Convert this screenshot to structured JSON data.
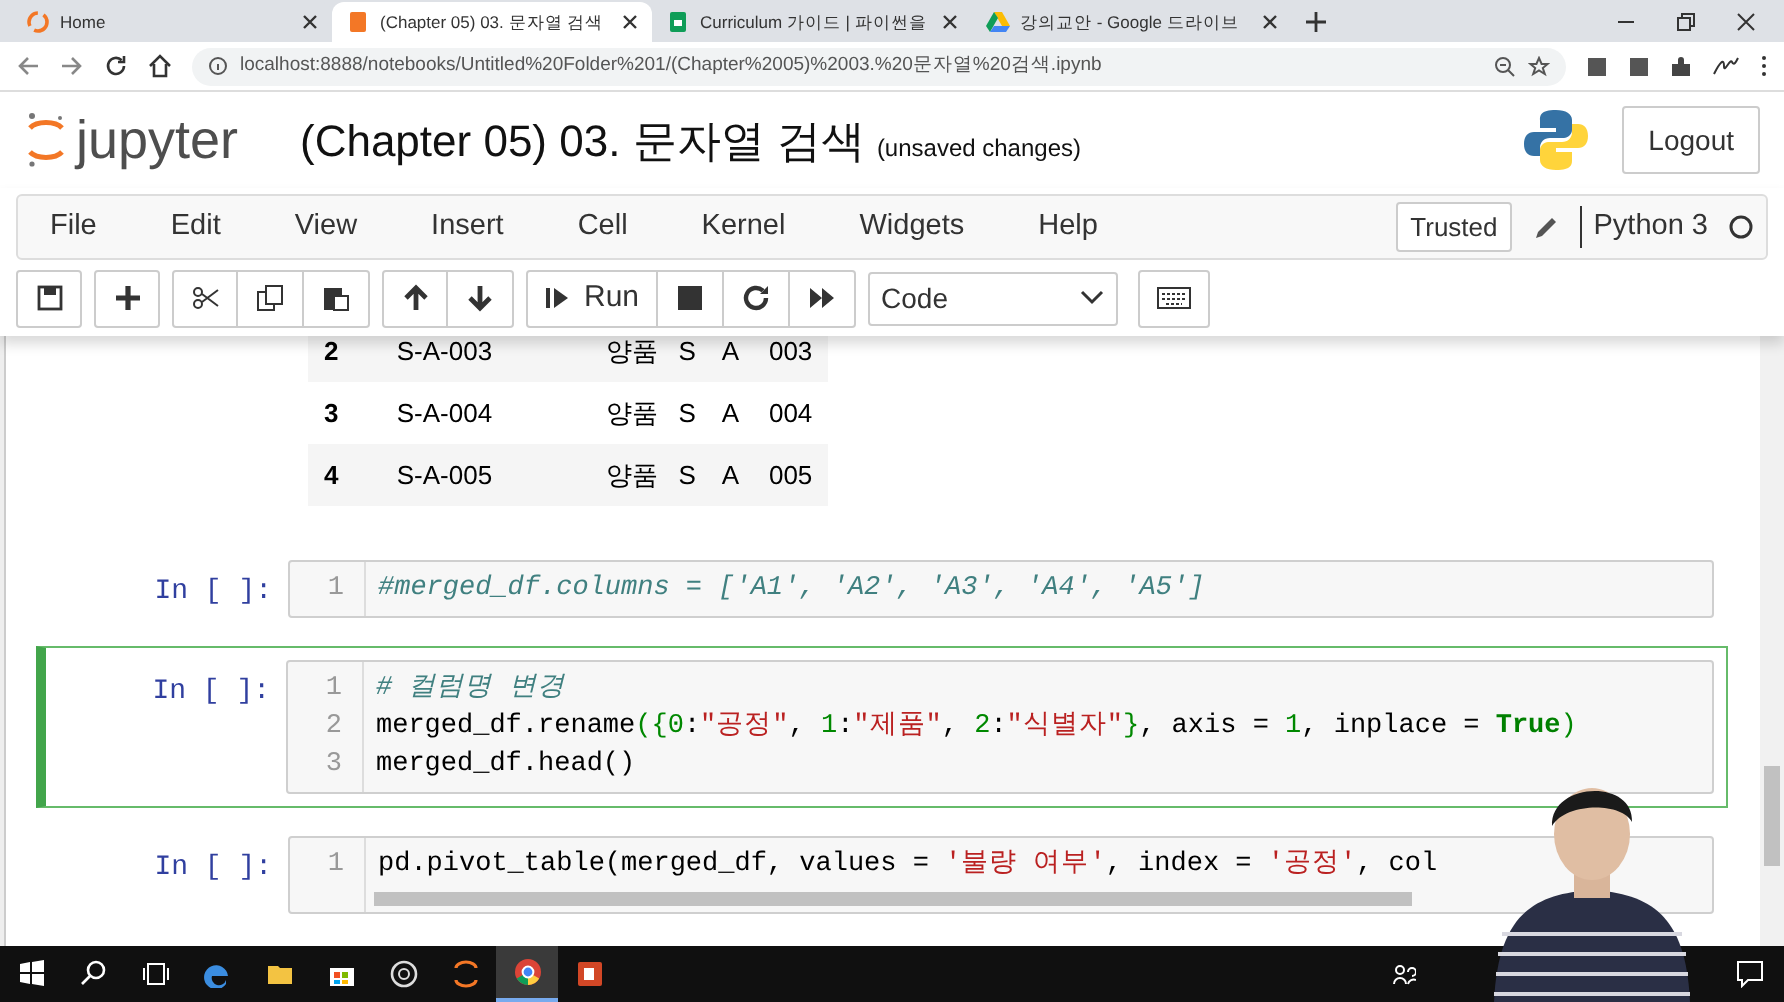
{
  "browser": {
    "tabs": [
      {
        "label": "Home",
        "selected": false,
        "kind": "jupyter"
      },
      {
        "label": "(Chapter 05) 03. 문자열 검색",
        "selected": true,
        "kind": "notebook"
      },
      {
        "label": "Curriculum 가이드 | 파이썬을",
        "selected": false,
        "kind": "sheets"
      },
      {
        "label": "강의교안 - Google 드라이브",
        "selected": false,
        "kind": "drive"
      }
    ],
    "address": "localhost:8888/notebooks/Untitled%20Folder%201/(Chapter%2005)%2003.%20문자열%20검색.ipynb"
  },
  "header": {
    "logo": "jupyter",
    "title": "(Chapter 05) 03. 문자열 검색",
    "status": "(unsaved changes)",
    "logout": "Logout"
  },
  "menu": {
    "items": [
      "File",
      "Edit",
      "View",
      "Insert",
      "Cell",
      "Kernel",
      "Widgets",
      "Help"
    ],
    "trusted": "Trusted",
    "kernel": "Python 3"
  },
  "toolbar": {
    "run": "Run",
    "cell_type": "Code"
  },
  "table": {
    "rows": [
      [
        "2",
        "S-A-003",
        "양품",
        "S",
        "A",
        "003"
      ],
      [
        "3",
        "S-A-004",
        "양품",
        "S",
        "A",
        "004"
      ],
      [
        "4",
        "S-A-005",
        "양품",
        "S",
        "A",
        "005"
      ]
    ]
  },
  "cells": [
    {
      "prompt": "In [ ]:",
      "selected": false,
      "scrollbar": false,
      "lines": [
        {
          "number": "1",
          "tokens": [
            {
              "text": "#merged_df.columns = ['A1', 'A2', 'A3', 'A4', 'A5']",
              "kind": "comment"
            }
          ]
        }
      ]
    },
    {
      "prompt": "In [ ]:",
      "selected": true,
      "scrollbar": false,
      "lines": [
        {
          "number": "1",
          "tokens": [
            {
              "text": "# 컬럼명 변경",
              "kind": "comment"
            }
          ]
        },
        {
          "number": "2",
          "tokens": [
            {
              "text": "merged_df.rename",
              "kind": "plain"
            },
            {
              "text": "({",
              "kind": "bracket"
            },
            {
              "text": "0",
              "kind": "number"
            },
            {
              "text": ":",
              "kind": "plain"
            },
            {
              "text": "\"공정\"",
              "kind": "string"
            },
            {
              "text": ", ",
              "kind": "plain"
            },
            {
              "text": "1",
              "kind": "number"
            },
            {
              "text": ":",
              "kind": "plain"
            },
            {
              "text": "\"제품\"",
              "kind": "string"
            },
            {
              "text": ", ",
              "kind": "plain"
            },
            {
              "text": "2",
              "kind": "number"
            },
            {
              "text": ":",
              "kind": "plain"
            },
            {
              "text": "\"식별자\"",
              "kind": "string"
            },
            {
              "text": "}",
              "kind": "bracket"
            },
            {
              "text": ", axis = ",
              "kind": "plain"
            },
            {
              "text": "1",
              "kind": "number"
            },
            {
              "text": ", inplace = ",
              "kind": "plain"
            },
            {
              "text": "True",
              "kind": "keyword"
            },
            {
              "text": ")",
              "kind": "bracket"
            }
          ]
        },
        {
          "number": "3",
          "tokens": [
            {
              "text": "merged_df.head()",
              "kind": "plain"
            }
          ]
        }
      ]
    },
    {
      "prompt": "In [ ]:",
      "selected": false,
      "scrollbar": true,
      "lines": [
        {
          "number": "1",
          "tokens": [
            {
              "text": "pd.pivot_table(merged_df, values = ",
              "kind": "plain"
            },
            {
              "text": "'불량 여부'",
              "kind": "string"
            },
            {
              "text": ", index = ",
              "kind": "plain"
            },
            {
              "text": "'공정'",
              "kind": "string"
            },
            {
              "text": ", col",
              "kind": "plain"
            }
          ]
        }
      ]
    }
  ],
  "taskbar": {
    "apps": [
      {
        "kind": "start",
        "selected": false
      },
      {
        "kind": "search",
        "selected": false
      },
      {
        "kind": "taskview",
        "selected": false
      },
      {
        "kind": "edge",
        "selected": false
      },
      {
        "kind": "folder",
        "selected": false
      },
      {
        "kind": "store",
        "selected": false
      },
      {
        "kind": "camera",
        "selected": false
      },
      {
        "kind": "jupyter",
        "selected": false
      },
      {
        "kind": "chrome",
        "selected": true
      },
      {
        "kind": "powerpoint",
        "selected": false
      }
    ]
  }
}
